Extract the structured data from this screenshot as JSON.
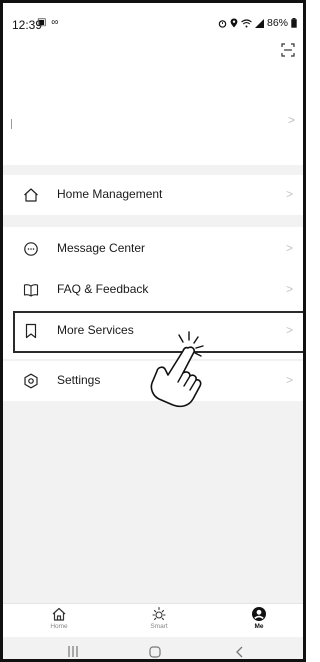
{
  "status_bar": {
    "time": "12:39",
    "left_icons": "▣ ∞",
    "battery": "86%"
  },
  "menu": {
    "home_management": "Home Management",
    "message_center": "Message Center",
    "faq_feedback": "FAQ & Feedback",
    "more_services": "More Services",
    "settings": "Settings"
  },
  "tabs": [
    {
      "label": "Home",
      "icon": "home-icon",
      "active": false
    },
    {
      "label": "Smart",
      "icon": "sun-icon",
      "active": false
    },
    {
      "label": "Me",
      "icon": "person-icon",
      "active": true
    }
  ],
  "colors": {
    "background": "#f2f2f2",
    "highlight_border": "#2b2b2b",
    "chevron": "#c4c4c4"
  }
}
